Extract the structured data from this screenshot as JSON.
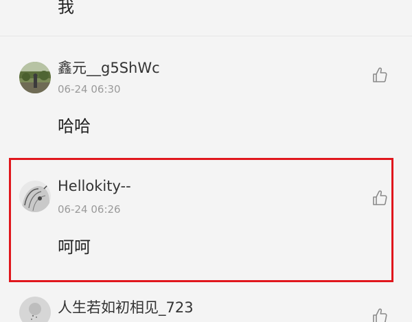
{
  "previous_comment": {
    "text": "我"
  },
  "comments": [
    {
      "username": "鑫元__g5ShWc",
      "time": "06-24 06:30",
      "content": "哈哈"
    },
    {
      "username": "Hellokity--",
      "time": "06-24 06:26",
      "content": "呵呵"
    },
    {
      "username": "人生若如初相见_723",
      "time": "",
      "content": ""
    }
  ],
  "colors": {
    "highlight_border": "#e0161c",
    "background": "#f4f4f4",
    "time_text": "#9a9a9a"
  },
  "icons": {
    "like": "thumbs-up-icon"
  }
}
